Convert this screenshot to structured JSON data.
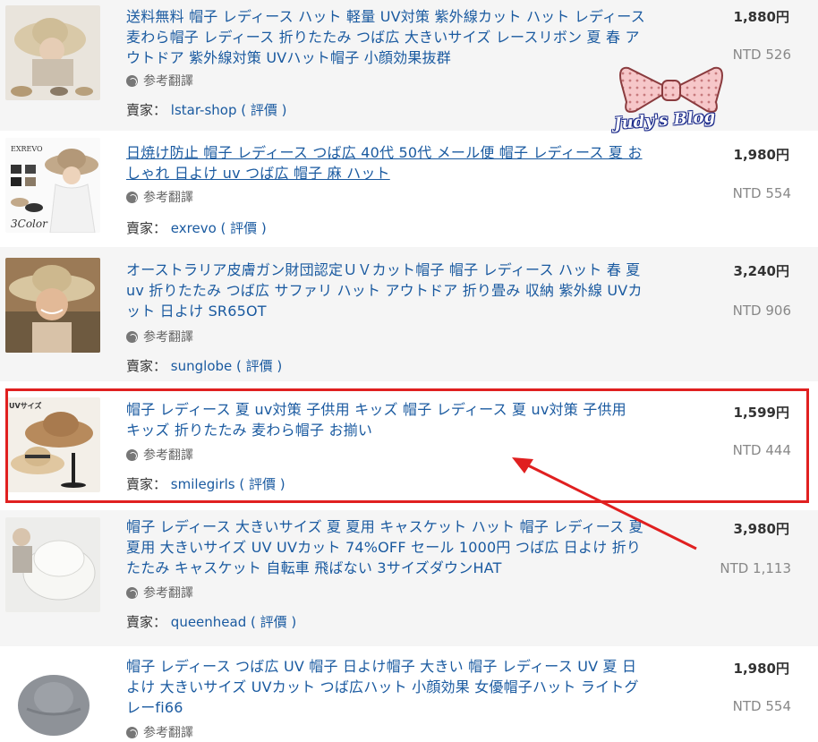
{
  "translate_label": "参考翻譯",
  "seller_prefix": "賣家：",
  "rating_label": "( 評價 )",
  "accent_color": "#1a5aa0",
  "highlight_color": "#e02020",
  "watermark": {
    "text": "Judy's Blog"
  },
  "listings": [
    {
      "title": "送料無料 帽子 レディース ハット 軽量 UV対策 紫外線カット ハット レディース 麦わら帽子 レディース 折りたたみ つば広 大きいサイズ レースリボン 夏 春 アウトドア 紫外線対策 UVハット帽子 小顔効果抜群",
      "seller": "lstar-shop",
      "price": "1,880円",
      "ntd": "NTD 526"
    },
    {
      "title": "日焼け防止 帽子 レディース つば広 40代 50代 メール便 帽子 レディース 夏 おしゃれ 日よけ uv つば広 帽子 麻 ハット",
      "seller": "exrevo",
      "price": "1,980円",
      "ntd": "NTD 554",
      "thumb_text": [
        "EXREVO",
        "3Color"
      ]
    },
    {
      "title": "オーストラリア皮膚ガン財団認定ＵＶカット帽子 帽子 レディース ハット 春 夏 uv 折りたたみ つば広 サファリ ハット アウトドア 折り畳み 収納 紫外線 UVカット 日よけ SR65OT",
      "seller": "sunglobe",
      "price": "3,240円",
      "ntd": "NTD 906"
    },
    {
      "title": "帽子 レディース 夏 uv対策 子供用 キッズ 帽子 レディース 夏 uv対策 子供用 キッズ 折りたたみ 麦わら帽子 お揃い",
      "seller": "smilegirls",
      "price": "1,599円",
      "ntd": "NTD 444",
      "thumb_text": [
        "UVサイズ"
      ]
    },
    {
      "title": "帽子 レディース 大きいサイズ 夏 夏用 キャスケット ハット 帽子 レディース 夏 夏用 大きいサイズ UV UVカット 74%OFF セール 1000円 つば広 日よけ 折りたたみ キャスケット 自転車 飛ばない 3サイズダウンHAT",
      "seller": "queenhead",
      "price": "3,980円",
      "ntd": "NTD 1,113"
    },
    {
      "title": "帽子 レディース つば広 UV 帽子 日よけ帽子 大きい 帽子 レディース UV 夏 日よけ 大きいサイズ UVカット つば広ハット 小顔効果 女優帽子ハット ライトグレーfi66",
      "price": "1,980円",
      "ntd": "NTD 554"
    }
  ]
}
